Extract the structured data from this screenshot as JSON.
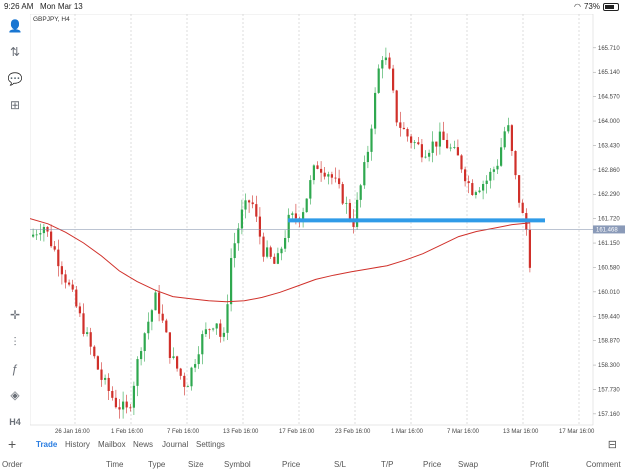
{
  "status_bar": {
    "time": "9:26 AM",
    "date": "Mon Mar 13",
    "battery": "73%",
    "battery_fraction": 0.73
  },
  "chart_data": {
    "type": "candlestick",
    "title": "GBPJPY, H4",
    "price_labels": [
      "165.710",
      "165.140",
      "164.570",
      "164.000",
      "163.430",
      "162.860",
      "162.290",
      "161.720",
      "161.150",
      "160.580",
      "160.010",
      "159.440",
      "158.870",
      "158.300",
      "157.730",
      "157.160"
    ],
    "price_ticks": [
      165.71,
      165.14,
      164.57,
      164.0,
      163.43,
      162.86,
      162.29,
      161.72,
      161.15,
      160.58,
      160.01,
      159.44,
      158.87,
      158.3,
      157.73,
      157.16
    ],
    "current_price_label": "161.468",
    "current_price": 161.468,
    "ylim": [
      156.9,
      166.5
    ],
    "time_labels": [
      "26 Jan 16:00",
      "1 Feb 16:00",
      "7 Feb 16:00",
      "13 Feb 16:00",
      "17 Feb 16:00",
      "23 Feb 16:00",
      "1 Mar 16:00",
      "7 Mar 16:00",
      "13 Mar 16:00",
      "17 Mar 16:00"
    ],
    "horizontal_line": {
      "price": 161.68,
      "color": "#2f9be8"
    },
    "moving_average": {
      "color": "#d0302a",
      "values": [
        161.72,
        161.6,
        161.4,
        161.15,
        160.85,
        160.5,
        160.25,
        160.05,
        159.9,
        159.85,
        159.8,
        159.78,
        159.8,
        159.88,
        160.0,
        160.15,
        160.3,
        160.4,
        160.48,
        160.55,
        160.62,
        160.75,
        160.9,
        161.1,
        161.3,
        161.42,
        161.5,
        161.58,
        161.62
      ]
    },
    "grid_vertical": true,
    "colors": {
      "bull": "#2fa84f",
      "bear": "#d0302a",
      "grid": "#c8c8c8"
    }
  },
  "sidebar": {
    "icons": [
      "person-icon",
      "trade-arrows-icon",
      "chat-icon",
      "document-plus-icon",
      "crosshair-icon",
      "indicators-icon",
      "function-icon",
      "objects-icon",
      "timeframe-icon"
    ],
    "timeframe": "H4"
  },
  "tabs": {
    "items": [
      "Trade",
      "History",
      "Mailbox",
      "News",
      "Journal",
      "Settings"
    ],
    "active": "Trade"
  },
  "table_columns": [
    "Order",
    "Time",
    "Type",
    "Size",
    "Symbol",
    "Price",
    "S/L",
    "T/P",
    "Price",
    "Swap",
    "Profit",
    "Comment"
  ]
}
